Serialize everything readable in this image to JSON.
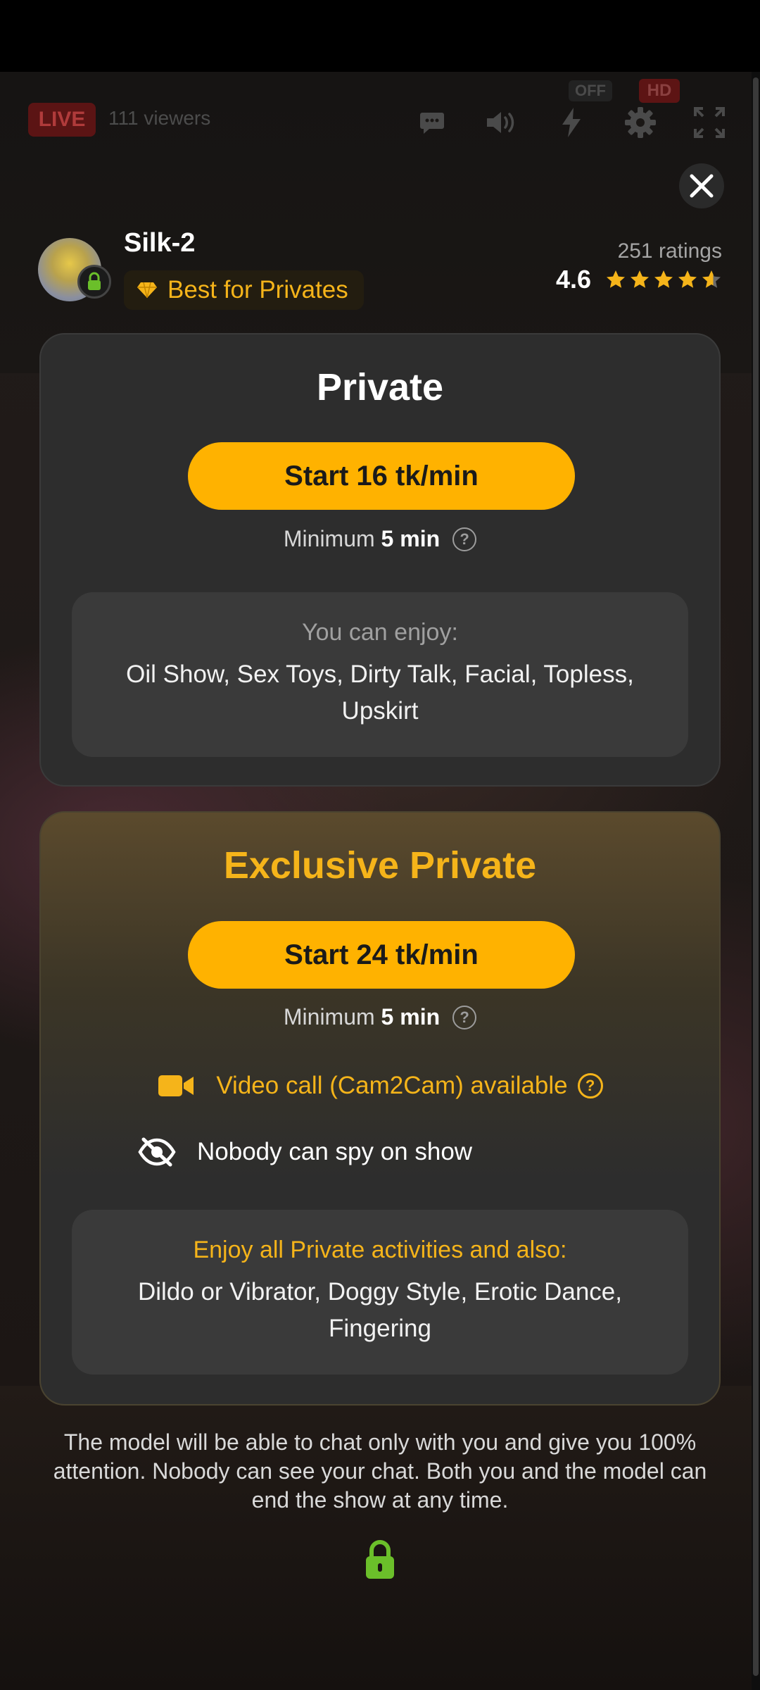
{
  "player": {
    "live_label": "LIVE",
    "viewers": "111 viewers",
    "flash_status": "OFF",
    "quality": "HD"
  },
  "model": {
    "name": "Silk-2",
    "badge": "Best for Privates",
    "ratings_count": "251 ratings",
    "rating": "4.6",
    "stars_value": 4.6
  },
  "private": {
    "title": "Private",
    "cta": "Start 16 tk/min",
    "minimum_prefix": "Minimum",
    "minimum_value": "5 min",
    "enjoy_label": "You can enjoy:",
    "enjoy_list": "Oil Show, Sex Toys, Dirty Talk, Facial, Topless, Upskirt"
  },
  "exclusive": {
    "title": "Exclusive Private",
    "cta": "Start 24 tk/min",
    "minimum_prefix": "Minimum",
    "minimum_value": "5 min",
    "feature_video": "Video call (Cam2Cam) available",
    "feature_spy": "Nobody can spy on show",
    "enjoy_label": "Enjoy all Private activities and also:",
    "enjoy_list": "Dildo or Vibrator, Doggy Style, Erotic Dance, Fingering"
  },
  "disclaimer": "The model will be able to chat only with you and give you 100% attention. Nobody can see your chat. Both you and the model can end the show at any time.",
  "colors": {
    "accent": "#ffb200",
    "accent_text": "#f5b41a",
    "lock_green": "#6bbf2a",
    "card_bg": "#2d2d2d"
  },
  "icons": [
    "chat-icon",
    "volume-icon",
    "flash-icon",
    "gear-icon",
    "fullscreen-icon",
    "close-icon",
    "lock-icon",
    "diamond-icon",
    "star-icon",
    "video-camera-icon",
    "eye-slash-icon",
    "help-icon"
  ]
}
